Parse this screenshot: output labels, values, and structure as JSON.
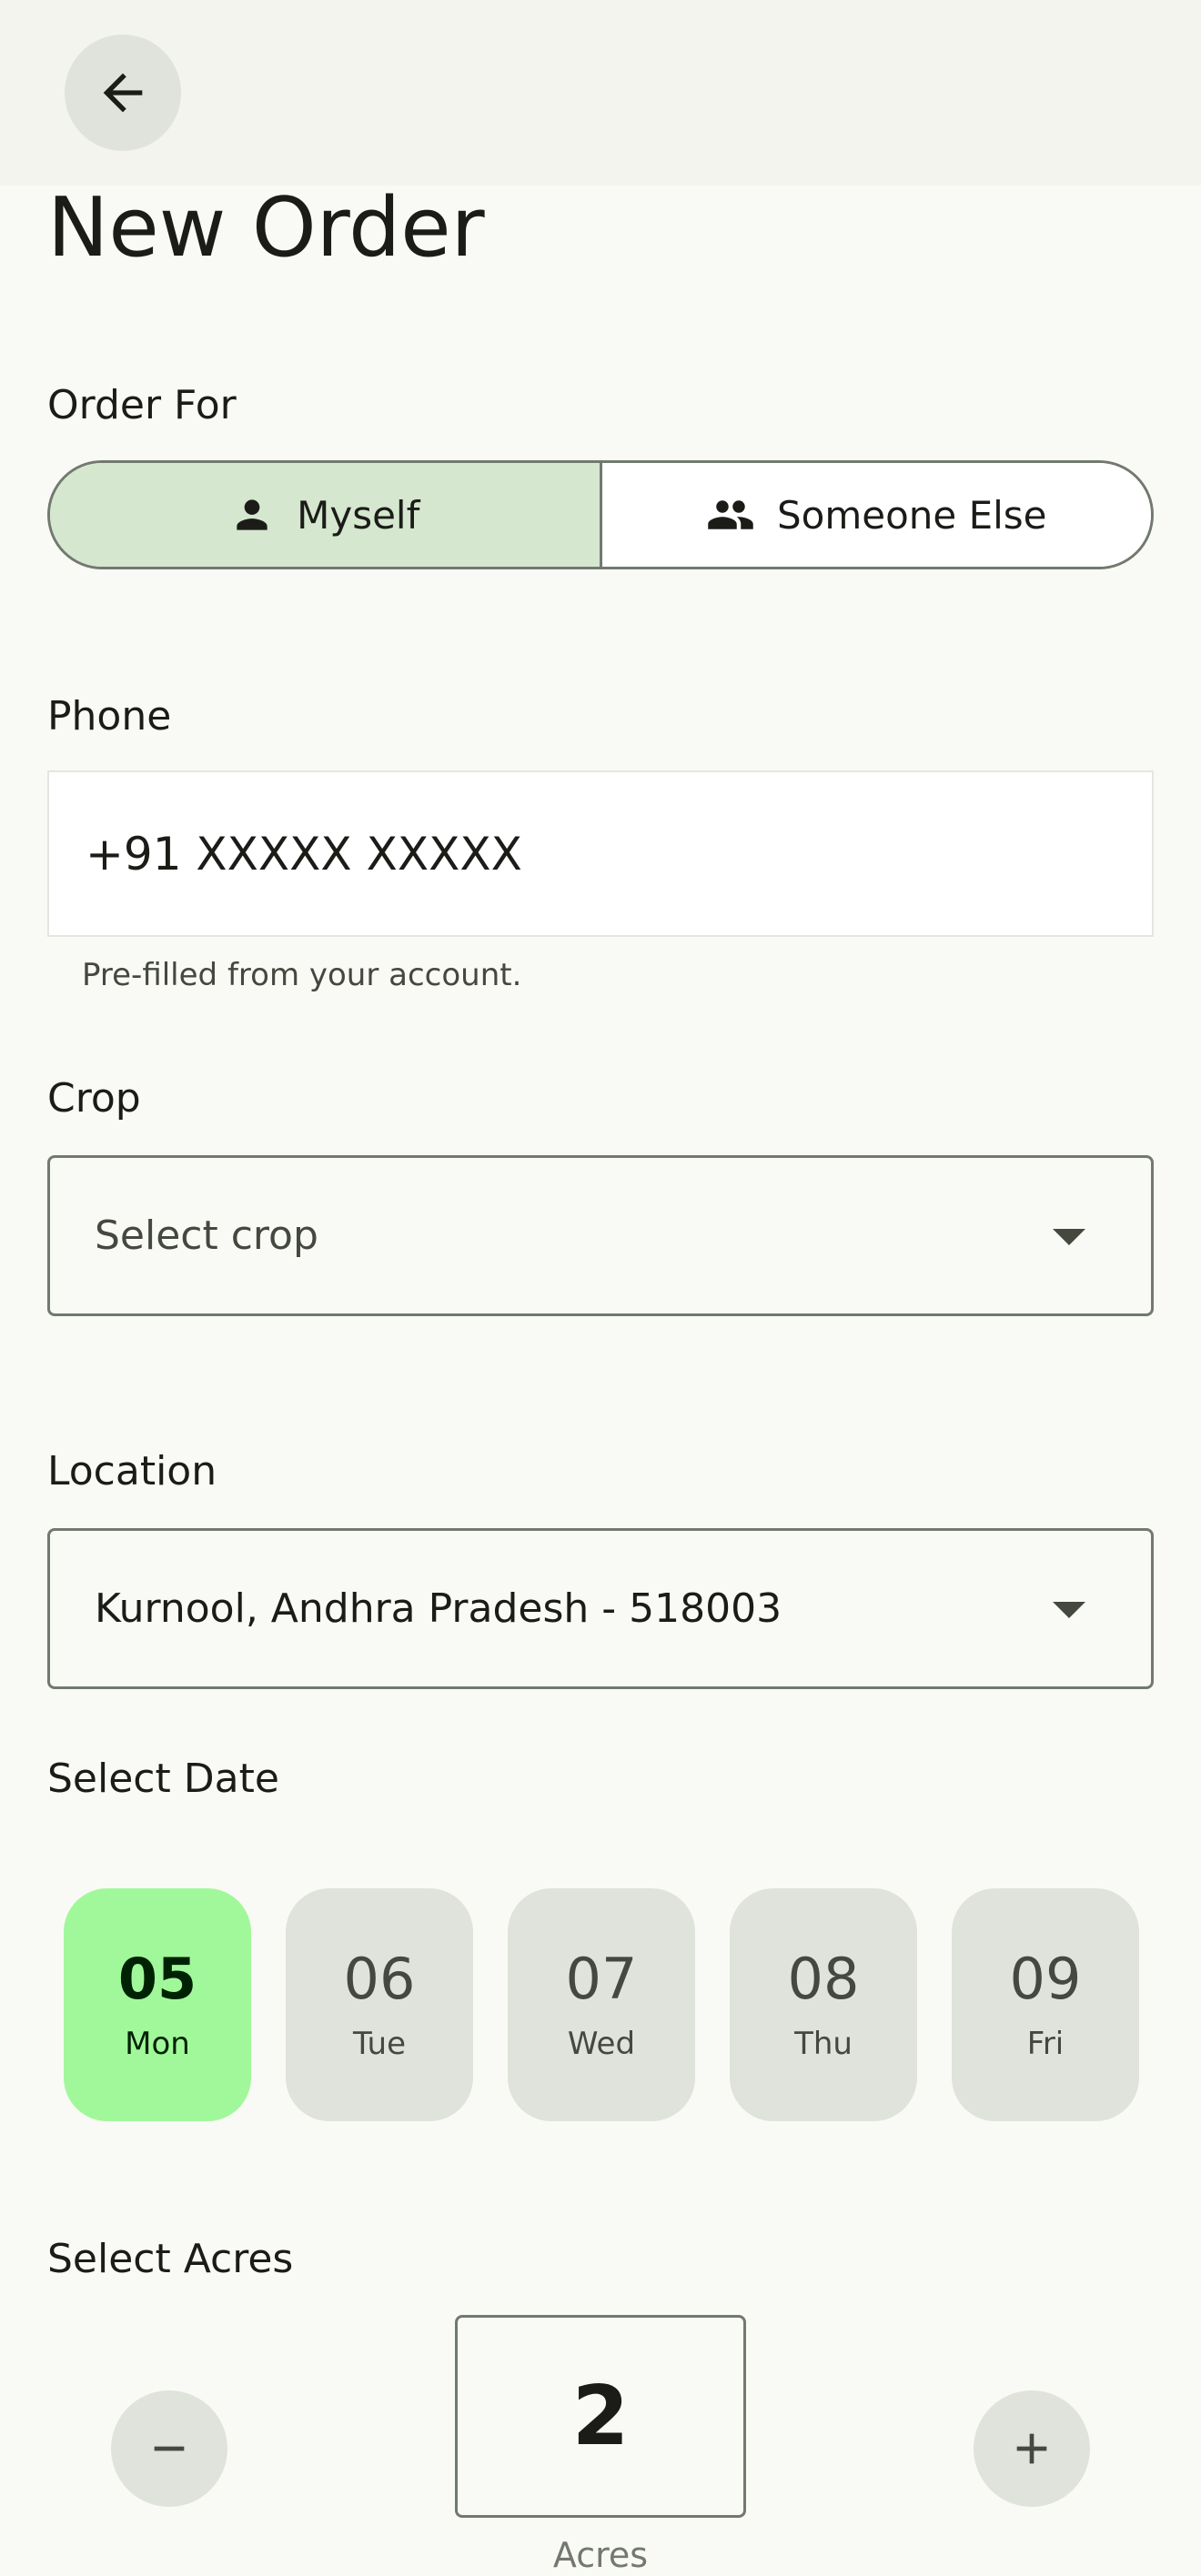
{
  "header": {
    "back_icon": "arrow-left-icon",
    "title": "New Order"
  },
  "order_for": {
    "label": "Order For",
    "options": [
      {
        "label": "Myself",
        "icon": "person-icon",
        "selected": true
      },
      {
        "label": "Someone Else",
        "icon": "people-icon",
        "selected": false
      }
    ]
  },
  "phone": {
    "label": "Phone",
    "value": "+91 XXXXX XXXXX",
    "helper": "Pre-filled from your account."
  },
  "crop": {
    "label": "Crop",
    "placeholder": "Select crop"
  },
  "location": {
    "label": "Location",
    "value": "Kurnool, Andhra Pradesh - 518003"
  },
  "date": {
    "label": "Select Date",
    "options": [
      {
        "num": "05",
        "day": "Mon",
        "selected": true
      },
      {
        "num": "06",
        "day": "Tue",
        "selected": false
      },
      {
        "num": "07",
        "day": "Wed",
        "selected": false
      },
      {
        "num": "08",
        "day": "Thu",
        "selected": false
      },
      {
        "num": "09",
        "day": "Fri",
        "selected": false
      }
    ]
  },
  "acres": {
    "label": "Select Acres",
    "value": "2",
    "unit": "Acres",
    "decrement_icon": "minus-icon",
    "increment_icon": "plus-icon"
  },
  "colors": {
    "background": "#f9faf5",
    "segment_selected": "#d5e7cf",
    "date_selected": "#a1f89a",
    "chip": "#dfe3db",
    "outline": "#72796f"
  }
}
